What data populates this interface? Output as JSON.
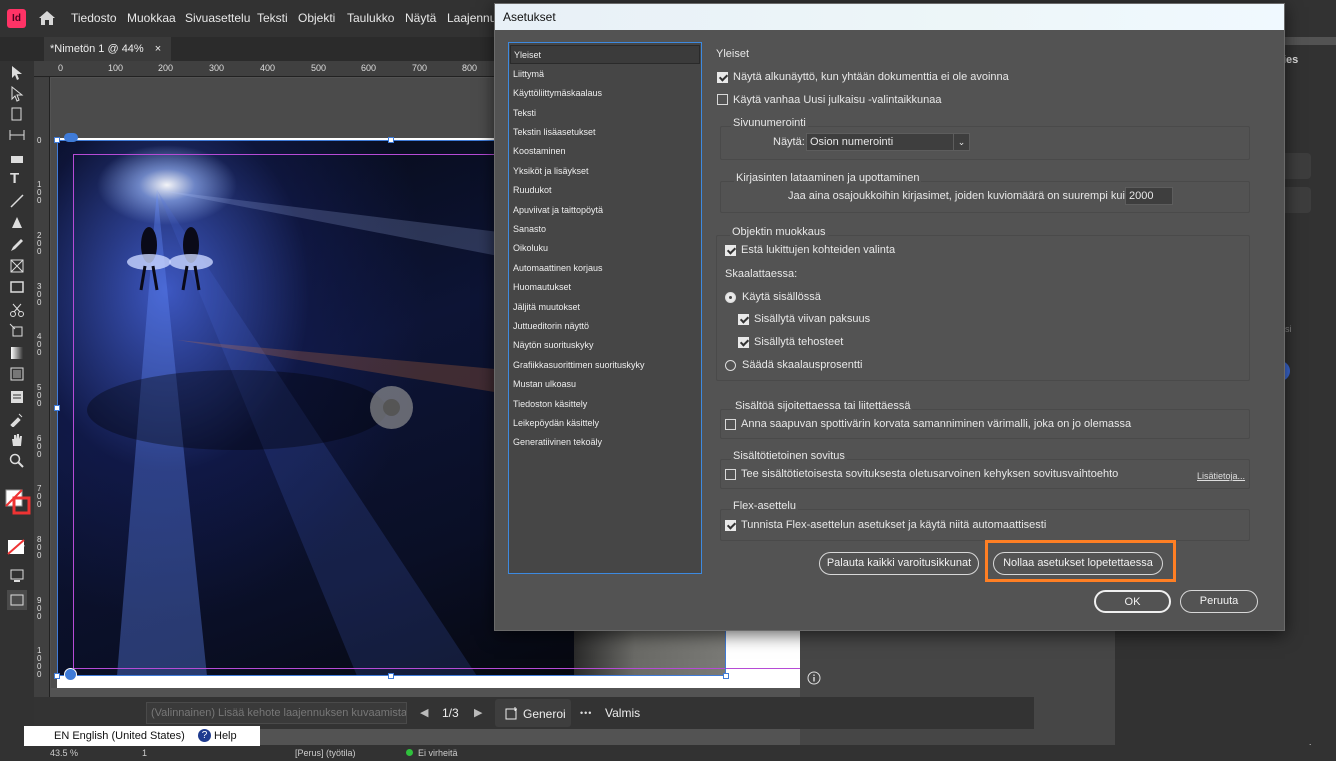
{
  "app": {
    "logo_label": "Id",
    "menu": [
      "Tiedosto",
      "Muokkaa",
      "Sivuasettelu",
      "Teksti",
      "Objekti",
      "Taulukko",
      "Näytä",
      "Laajennu"
    ],
    "doc_tab": "*Nimetön 1 @ 44%",
    "doc_tab_close": "×",
    "panel_fragment": "ies",
    "panel_fragment2": "isi"
  },
  "rulers": {
    "h_ticks": [
      "0",
      "100",
      "200",
      "300",
      "400",
      "500",
      "600",
      "700",
      "800"
    ],
    "v_ticks": [
      "0",
      "1 0 0",
      "2 0 0",
      "3 0 0",
      "4 0 0",
      "5 0 0",
      "6 0 0",
      "7 0 0",
      "8 0 0",
      "9 0 0",
      "1 0 0 0"
    ]
  },
  "generate_bar": {
    "placeholder": "(Valinnainen) Lisää kehote laajennuksen kuvaamista varten",
    "page_indicator": "1/3",
    "generate_label": "Generoi",
    "more_label": "•••",
    "done_label": "Valmis"
  },
  "status": {
    "zoom": "43.5 %",
    "page": "1",
    "style": "[Perus] (työtila)",
    "errors": "Ei virheitä",
    "language": "EN English (United States)",
    "help": "Help"
  },
  "dialog": {
    "title": "Asetukset",
    "categories": [
      "Yleiset",
      "Liittymä",
      "Käyttöliittymäskaalaus",
      "Teksti",
      "Tekstin lisäasetukset",
      "Koostaminen",
      "Yksiköt ja lisäykset",
      "Ruudukot",
      "Apuviivat ja taittopöytä",
      "Sanasto",
      "Oikoluku",
      "Automaattinen korjaus",
      "Huomautukset",
      "Jäljitä muutokset",
      "Juttueditorin näyttö",
      "Näytön suorituskyky",
      "Grafiikkasuorittimen suorituskyky",
      "Mustan ulkoasu",
      "Tiedoston käsittely",
      "Leikepöydän käsittely",
      "Generatiivinen tekoäly"
    ],
    "section_title": "Yleiset",
    "show_start": "Näytä alkunäyttö, kun yhtään dokumenttia ei ole avoinna",
    "legacy_new": "Käytä vanhaa Uusi julkaisu -valintaikkunaa",
    "page_numbering": {
      "legend": "Sivunumerointi",
      "view_label": "Näytä:",
      "view_value": "Osion numerointi"
    },
    "font_download": {
      "legend": "Kirjasinten lataaminen ja upottaminen",
      "label": "Jaa aina osajoukkoihin kirjasimet, joiden kuviomäärä on suurempi kuin:",
      "value": "2000"
    },
    "object_edit": {
      "legend": "Objektin muokkaus",
      "prevent_locked": "Estä lukittujen kohteiden valinta",
      "scaling_label": "Skaalattaessa:",
      "apply_content": "Käytä sisällössä",
      "include_stroke": "Sisällytä viivan paksuus",
      "include_effects": "Sisällytä tehosteet",
      "adjust_percent": "Säädä skaalausprosentti"
    },
    "paste": {
      "legend": "Sisältöä sijoitettaessa tai liitettäessä",
      "label": "Anna saapuvan spottivärin korvata samanniminen värimalli, joka on jo olemassa"
    },
    "content_fit": {
      "legend": "Sisältötietoinen sovitus",
      "label": "Tee sisältötietoisesta sovituksesta oletusarvoinen kehyksen sovitusvaihtoehto",
      "link": "Lisätietoja..."
    },
    "flex": {
      "legend": "Flex-asettelu",
      "label": "Tunnista Flex-asettelun asetukset ja käytä niitä automaattisesti"
    },
    "buttons": {
      "reset_warnings": "Palauta kaikki varoitusikkunat",
      "reset_prefs": "Nollaa asetukset lopetettaessa",
      "ok": "OK",
      "cancel": "Peruuta"
    }
  },
  "colors": {
    "highlight": "#ff7f24",
    "selection": "#3f7bd8",
    "margin": "#b64bd6"
  }
}
